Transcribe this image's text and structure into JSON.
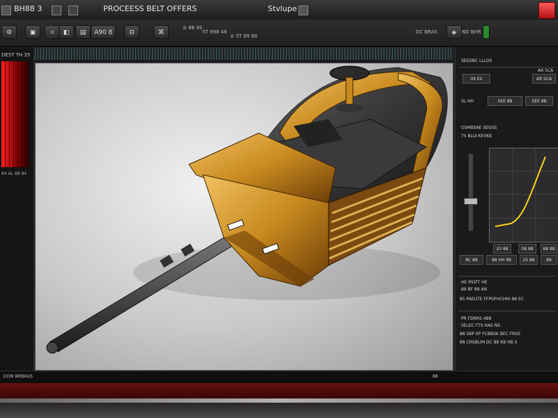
{
  "window": {
    "left_title": "BH88 3",
    "center_title": "PROCEESS BELT OFFERS",
    "right_title": "Stvlupe"
  },
  "toolbar": {
    "buttons": [
      "⚙",
      "▣",
      "⌗",
      "◧",
      "▤",
      "⊟",
      "⌘",
      "◈"
    ],
    "labels": [
      "A90 8",
      "⊘ 88 45",
      "5T 898 48",
      "⊘ 5T 89 88"
    ],
    "right_labels": [
      "DC BRAS",
      "ND BHR"
    ]
  },
  "left_panel": {
    "header": "DEST TH 35",
    "footer": "84 AL 88 84"
  },
  "right_panel": {
    "header": "SEEDBC LLLOS",
    "rows": [
      {
        "label": "AR SCA",
        "value": "04 ES"
      },
      {
        "label": "SL HH",
        "value": "SEE 88"
      }
    ],
    "section2": "OSMBSAE SEGSS",
    "section2_sub": "75 BLUI KEVKE",
    "graph_labels": [
      "20 88",
      "08 88",
      "88 88"
    ],
    "row3": [
      "RC 88",
      "88 HH 88",
      "25 88",
      "88"
    ],
    "section3": "HE PIOFT HE",
    "section3_sub": "88 BF 88 AN",
    "section3_line": "85 PAEUTE FFPDFHCHHI 88 EC",
    "section4": "PR FDRRS 488",
    "section4_sub": "SELEC FTS HAS NS",
    "section4_lines": [
      "88 SBP EP FCBBSK BEC FRSS",
      "88 CRSBLIM DC 88 KB HB S"
    ]
  },
  "status": {
    "left": "1038 WEBIIUS",
    "right": "88"
  },
  "colors": {
    "accent_red": "#c41414",
    "part_gold": "#c8891e",
    "graph_line": "#ffd21a"
  }
}
